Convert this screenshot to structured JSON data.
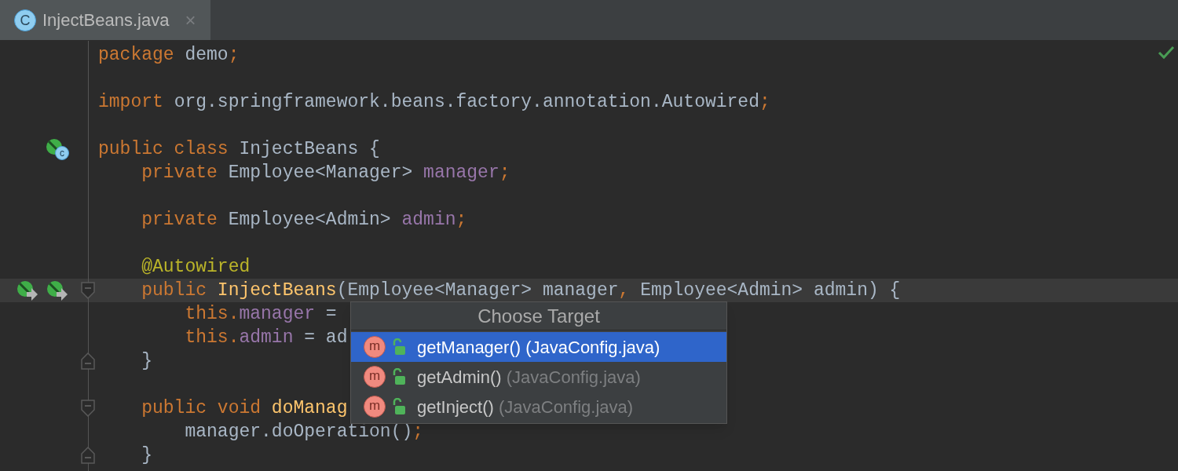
{
  "tab": {
    "title": "InjectBeans.java",
    "badge": "C",
    "selected": true,
    "close": "×"
  },
  "code_lines": [
    {
      "kind": "code",
      "current": false,
      "tokens": [
        {
          "kind": "keyword",
          "text": "package "
        },
        {
          "kind": "plain",
          "text": "demo"
        },
        {
          "kind": "keyword",
          "text": ";"
        }
      ]
    },
    {
      "kind": "blank",
      "current": false
    },
    {
      "kind": "code",
      "current": false,
      "tokens": [
        {
          "kind": "keyword",
          "text": "import "
        },
        {
          "kind": "plain",
          "text": "org.springframework.beans.factory.annotation.Autowired"
        },
        {
          "kind": "keyword",
          "text": ";"
        }
      ]
    },
    {
      "kind": "blank",
      "current": false
    },
    {
      "kind": "code",
      "current": false,
      "tokens": [
        {
          "kind": "keyword",
          "text": "public class "
        },
        {
          "kind": "plain",
          "text": "InjectBeans {"
        }
      ],
      "gutter": [
        {
          "kind": "bean-class",
          "badge": "c"
        }
      ]
    },
    {
      "kind": "code",
      "current": false,
      "tokens": [
        {
          "kind": "keyword",
          "text": "    private "
        },
        {
          "kind": "plain",
          "text": "Employee<Manager> "
        },
        {
          "kind": "field",
          "text": "manager"
        },
        {
          "kind": "keyword",
          "text": ";"
        }
      ]
    },
    {
      "kind": "blank",
      "current": false
    },
    {
      "kind": "code",
      "current": false,
      "tokens": [
        {
          "kind": "keyword",
          "text": "    private "
        },
        {
          "kind": "plain",
          "text": "Employee<Admin> "
        },
        {
          "kind": "field",
          "text": "admin"
        },
        {
          "kind": "keyword",
          "text": ";"
        }
      ]
    },
    {
      "kind": "blank",
      "current": false
    },
    {
      "kind": "code",
      "current": false,
      "tokens": [
        {
          "kind": "annotation",
          "text": "    @Autowired"
        }
      ]
    },
    {
      "kind": "code",
      "current": true,
      "tokens": [
        {
          "kind": "keyword",
          "text": "    public "
        },
        {
          "kind": "method",
          "text": "InjectBeans"
        },
        {
          "kind": "plain",
          "text": "(Employee<Manager> manager"
        },
        {
          "kind": "keyword",
          "text": ", "
        },
        {
          "kind": "plain",
          "text": "Employee<Admin> admin) {"
        }
      ],
      "gutter": [
        {
          "kind": "bean-navigate"
        },
        {
          "kind": "bean-navigate"
        }
      ],
      "fold": {
        "kind": "start"
      }
    },
    {
      "kind": "code",
      "current": false,
      "tokens": [
        {
          "kind": "keyword",
          "text": "        this."
        },
        {
          "kind": "field",
          "text": "manager"
        },
        {
          "kind": "plain",
          "text": " ="
        }
      ]
    },
    {
      "kind": "code",
      "current": false,
      "tokens": [
        {
          "kind": "keyword",
          "text": "        this."
        },
        {
          "kind": "field",
          "text": "admin"
        },
        {
          "kind": "plain",
          "text": " = ad"
        }
      ]
    },
    {
      "kind": "code",
      "current": false,
      "tokens": [
        {
          "kind": "plain",
          "text": "    }"
        }
      ],
      "fold": {
        "kind": "end"
      }
    },
    {
      "kind": "blank",
      "current": false
    },
    {
      "kind": "code",
      "current": false,
      "tokens": [
        {
          "kind": "keyword",
          "text": "    public void "
        },
        {
          "kind": "method",
          "text": "doManag"
        }
      ],
      "fold": {
        "kind": "start"
      }
    },
    {
      "kind": "code",
      "current": false,
      "tokens": [
        {
          "kind": "plain",
          "text": "        manager.doOperation()"
        },
        {
          "kind": "keyword",
          "text": ";"
        }
      ]
    },
    {
      "kind": "code",
      "current": false,
      "tokens": [
        {
          "kind": "plain",
          "text": "    }"
        }
      ],
      "fold": {
        "kind": "end"
      }
    }
  ],
  "popup": {
    "title": "Choose Target",
    "items": [
      {
        "badge": "m",
        "name": "getManager()",
        "location": "(JavaConfig.java)",
        "selected": true
      },
      {
        "badge": "m",
        "name": "getAdmin()",
        "location": "(JavaConfig.java)",
        "selected": false
      },
      {
        "badge": "m",
        "name": "getInject()",
        "location": "(JavaConfig.java)",
        "selected": false
      }
    ]
  }
}
